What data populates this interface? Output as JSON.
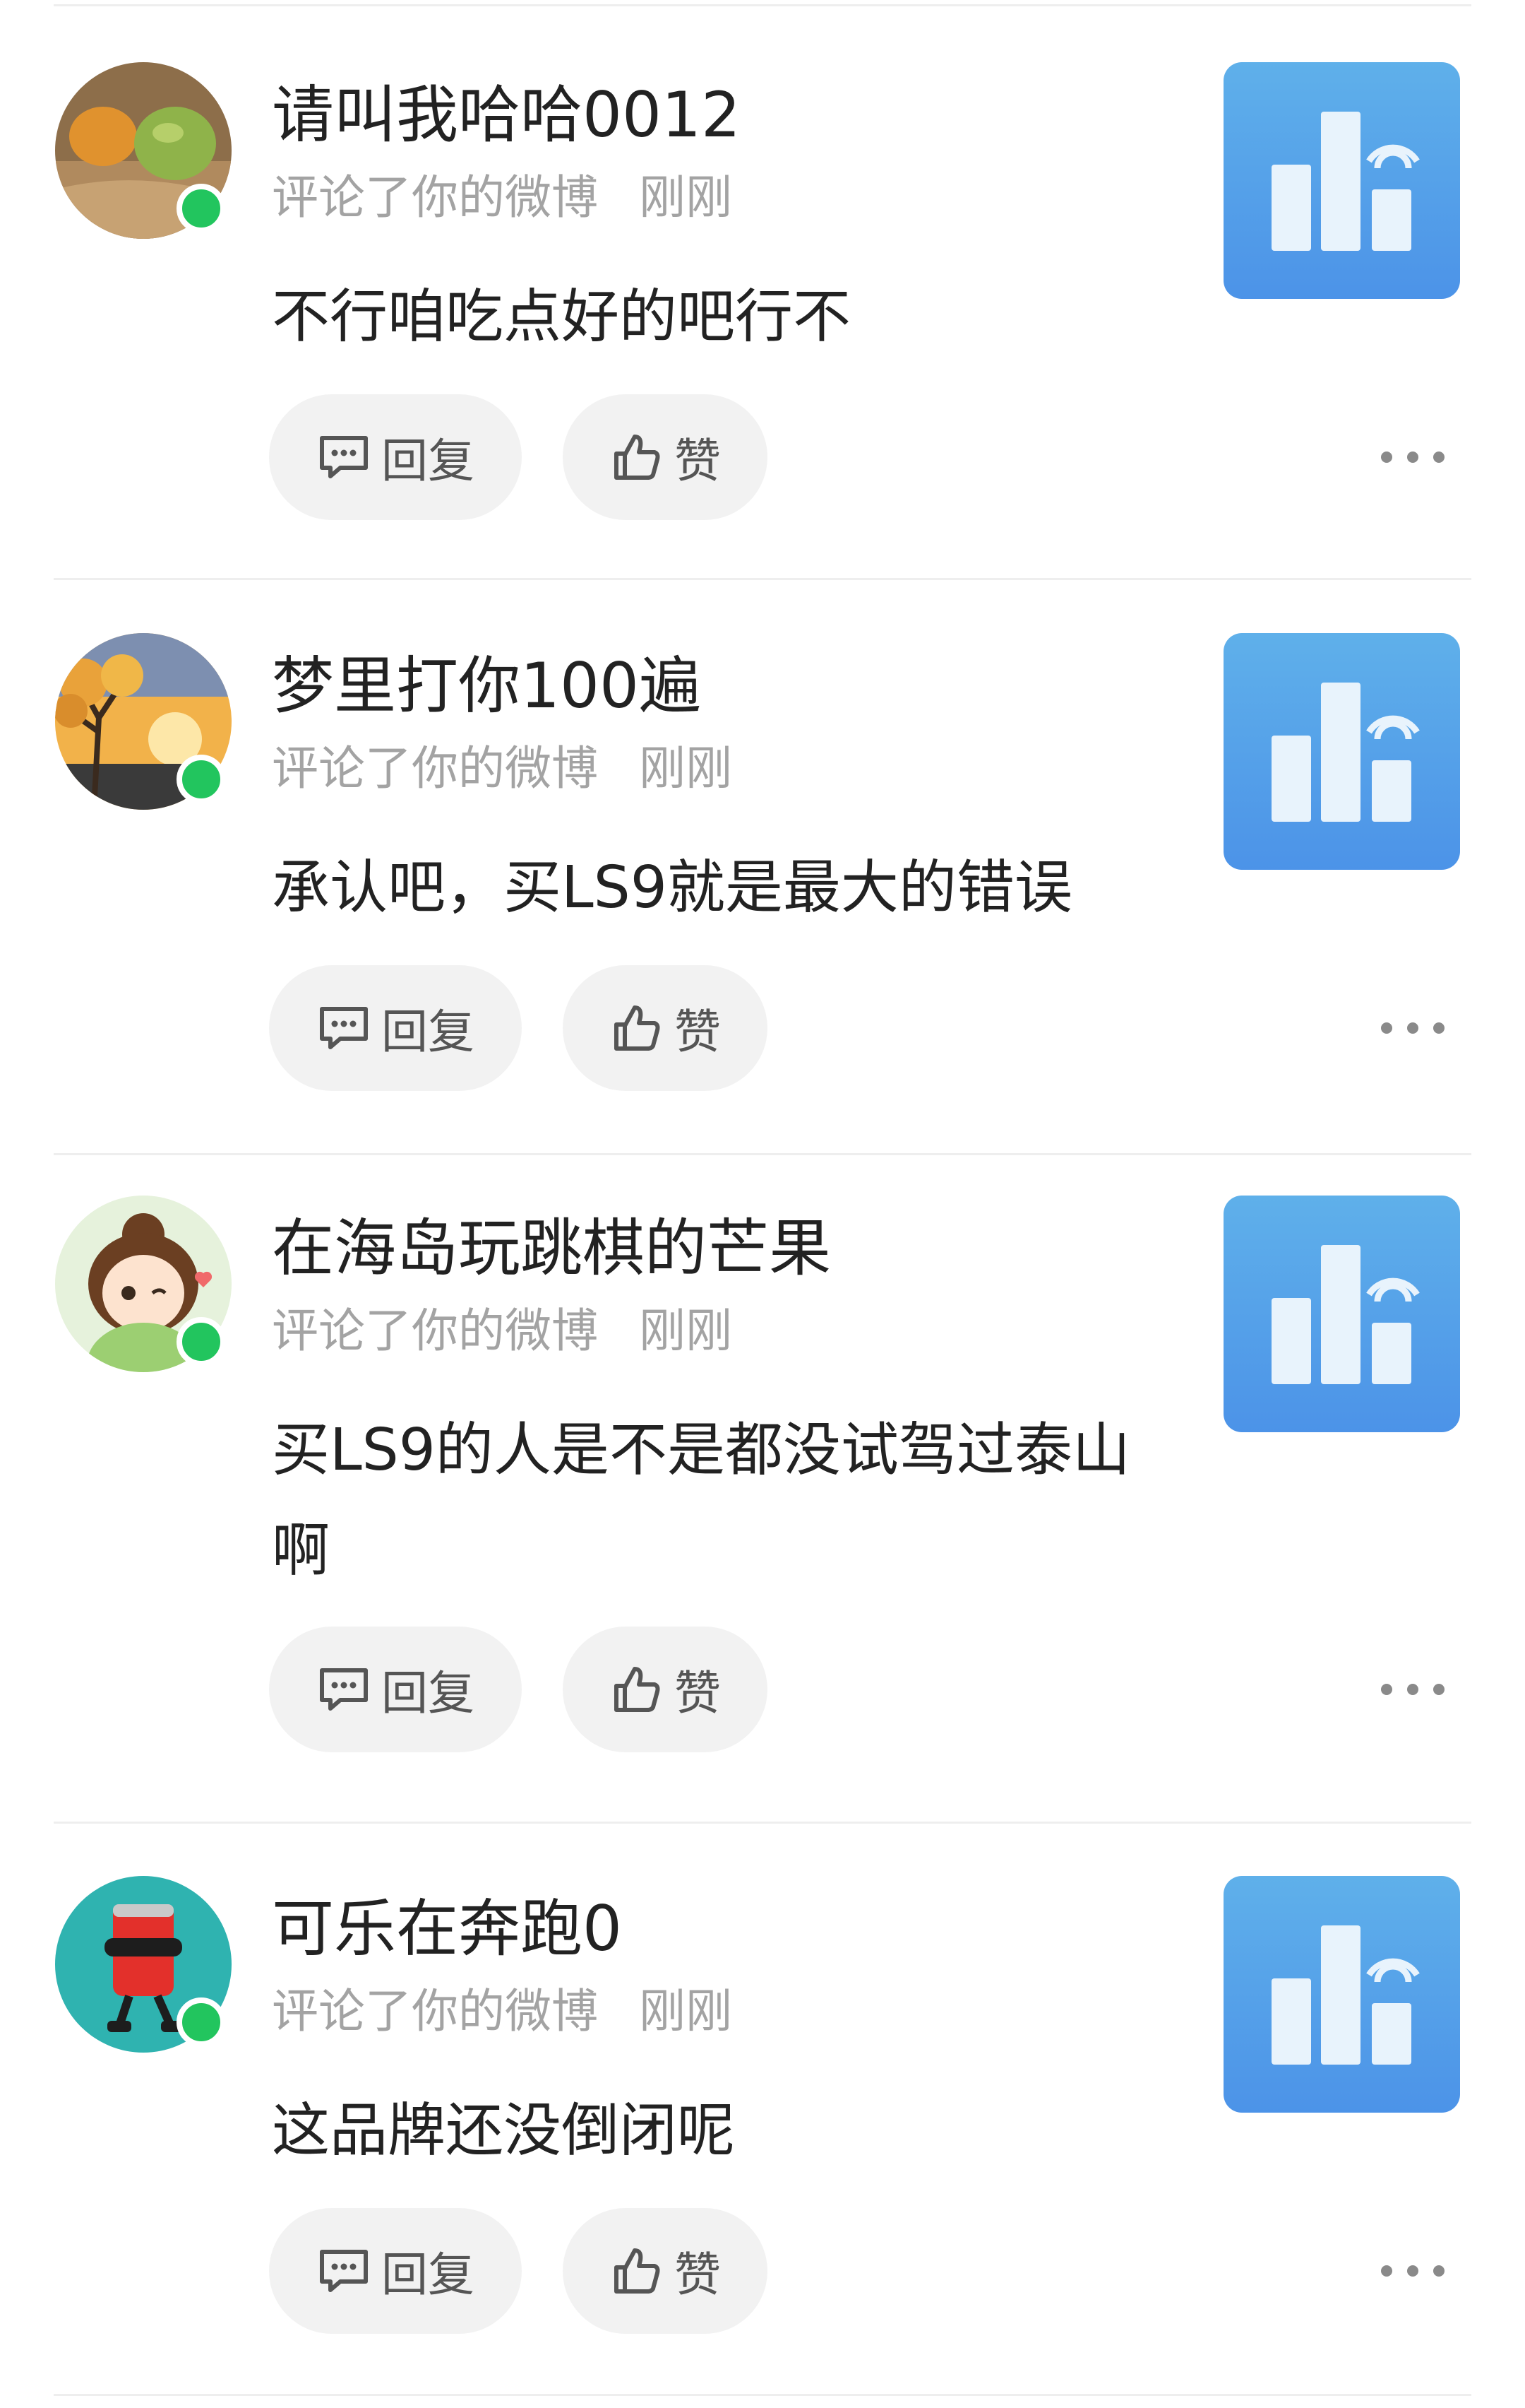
{
  "comments": [
    {
      "username": "请叫我哈哈0012",
      "action": "评论了你的微博",
      "time": "刚刚",
      "text": "不行咱吃点好的吧行不",
      "avatar": "fruit-photo-avatar",
      "reply_label": "回复",
      "like_label": "赞"
    },
    {
      "username": "梦里打你100遍",
      "action": "评论了你的微博",
      "time": "刚刚",
      "text": "承认吧，买LS9就是最大的错误",
      "avatar": "sunset-tree-avatar",
      "reply_label": "回复",
      "like_label": "赞"
    },
    {
      "username": "在海岛玩跳棋的芒果",
      "action": "评论了你的微博",
      "time": "刚刚",
      "text": "买LS9的人是不是都没试驾过泰山啊",
      "avatar": "cartoon-girl-avatar",
      "reply_label": "回复",
      "like_label": "赞"
    },
    {
      "username": "可乐在奔跑0",
      "action": "评论了你的微博",
      "time": "刚刚",
      "text": "这品牌还没倒闭呢",
      "avatar": "running-can-avatar",
      "reply_label": "回复",
      "like_label": "赞"
    }
  ],
  "colors": {
    "online": "#22c55e",
    "thumbnail": "#5aa6ea",
    "meta_text": "#a3a3a3",
    "button_bg": "#f2f2f2"
  },
  "icons": {
    "reply": "comment-bubble-icon",
    "like": "thumbs-up-icon",
    "more": "more-dots-icon",
    "thumbnail": "signal-bars-icon"
  }
}
